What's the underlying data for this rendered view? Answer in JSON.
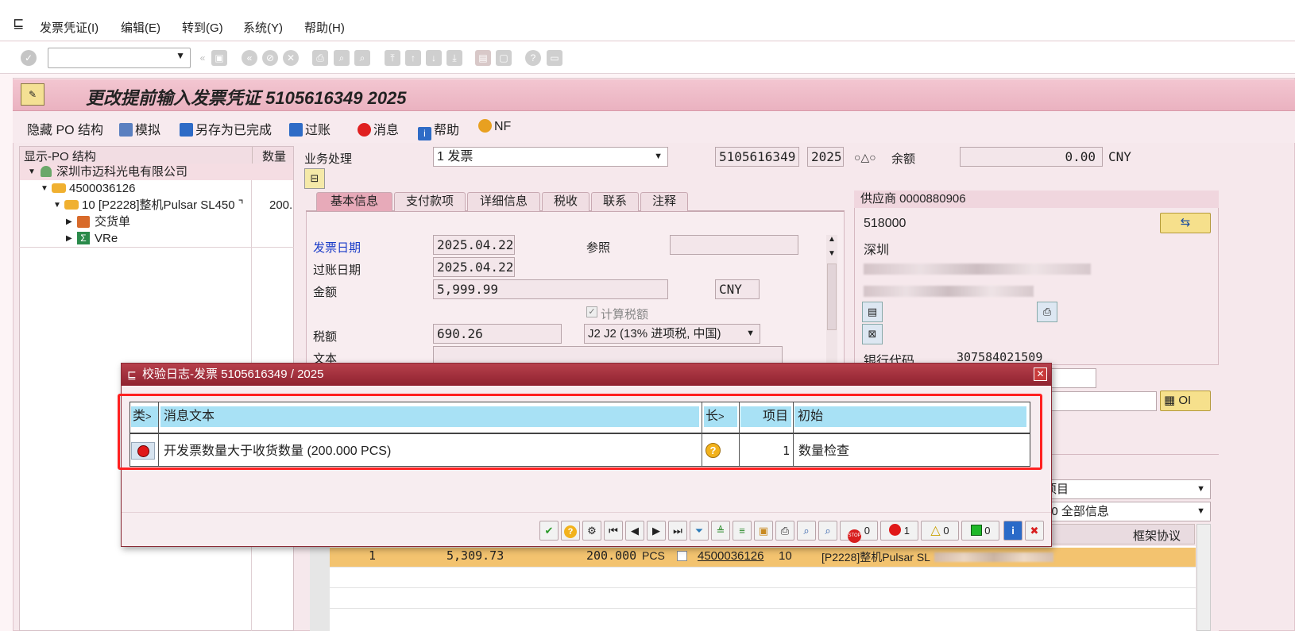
{
  "menu": {
    "items": [
      "发票凭证(I)",
      "编辑(E)",
      "转到(G)",
      "系统(Y)",
      "帮助(H)"
    ]
  },
  "page": {
    "title": "更改提前输入发票凭证 5105616349 2025"
  },
  "app_toolbar": {
    "hide_po": "隐藏 PO 结构",
    "simulate": "模拟",
    "save_complete": "另存为已完成",
    "post": "过账",
    "messages": "消息",
    "help": "帮助",
    "nf": "NF"
  },
  "tree": {
    "col_structure": "显示-PO 结构",
    "col_qty": "数量",
    "vendor": "深圳市迈科光电有限公司",
    "po": "4500036126",
    "item": "10 [P2228]整机Pulsar SL450 ⌝",
    "item_qty": "200.",
    "delivery": "交货单",
    "vre": "VRe"
  },
  "header": {
    "transaction_label": "业务处理",
    "transaction_value": "1 发票",
    "doc_number": "5105616349",
    "year": "2025",
    "balance_label": "余额",
    "balance_value": "0.00",
    "balance_currency": "CNY"
  },
  "tabs": [
    "基本信息",
    "支付款项",
    "详细信息",
    "税收",
    "联系",
    "注释"
  ],
  "basic": {
    "invoice_date_label": "发票日期",
    "invoice_date": "2025.04.22",
    "reference_label": "参照",
    "posting_date_label": "过账日期",
    "posting_date": "2025.04.22",
    "amount_label": "金额",
    "amount": "5,999.99",
    "currency": "CNY",
    "calc_tax_label": "计算税额",
    "tax_label": "税额",
    "tax_amount": "690.26",
    "tax_code": "J2 J2 (13% 进项税, 中国)",
    "text_label": "文本"
  },
  "supplier": {
    "title": "供应商 0000880906",
    "postal": "518000",
    "city": "深圳",
    "bank_code_label": "银行代码",
    "bank_code": "307584021509",
    "oi_label": "OI"
  },
  "right_lower": {
    "dropdown1": "项目",
    "dropdown2": "10 全部信息",
    "frame_agreement": "框架协议"
  },
  "items_table": {
    "rows": [
      {
        "item": "1",
        "amount": "5,309.73",
        "qty": "200.000",
        "unit": "PCS",
        "po": "4500036126",
        "po_item": "10",
        "text": "[P2228]整机Pulsar SL"
      }
    ]
  },
  "dialog": {
    "title": "校验日志-发票 5105616349 / 2025",
    "col_type": "类",
    "col_message": "消息文本",
    "col_long": "长",
    "col_item": "项目",
    "col_origin": "初始",
    "message_text": "开发票数量大于收货数量 (200.000 PCS)",
    "item_no": "1",
    "origin": "数量检查",
    "counts": {
      "stop": "0",
      "error": "1",
      "warning": "0",
      "success": "0"
    }
  },
  "colors": {
    "title_bar": "#eab2c0",
    "dialog_title": "#8f2230",
    "grid_header": "#a8e1f5",
    "highlight_row": "#f3c36f",
    "red_box": "#ff2020"
  }
}
